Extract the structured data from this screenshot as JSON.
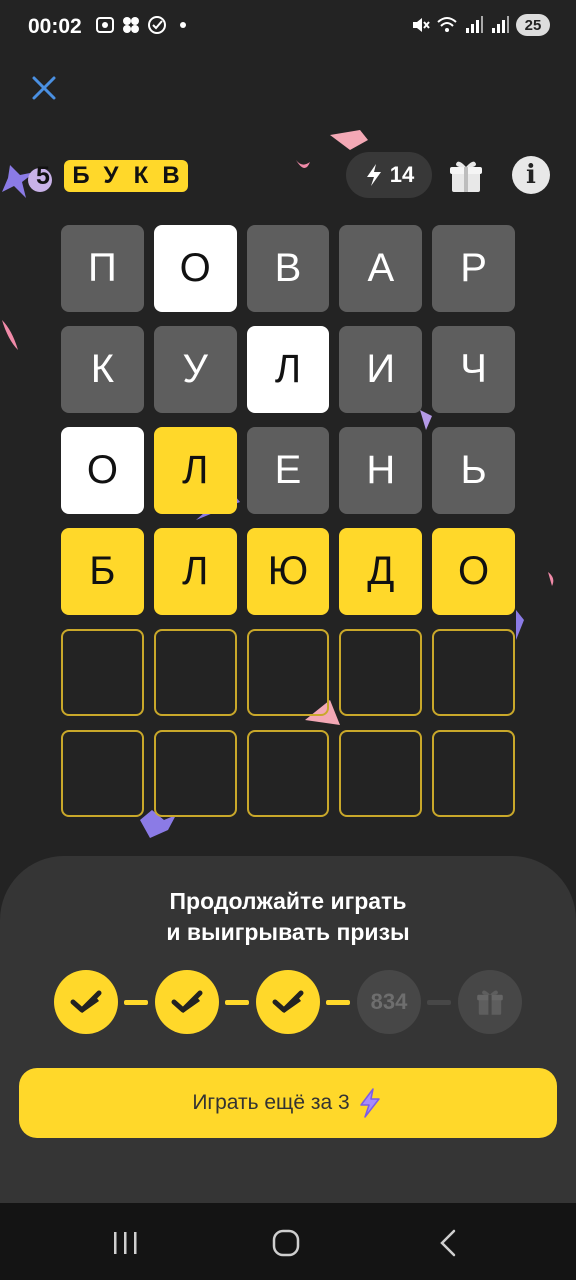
{
  "status_bar": {
    "time": "00:02",
    "battery": "25",
    "icons_left": [
      "screenshot-icon",
      "apps-icon",
      "check-circle-icon",
      "dot-icon"
    ],
    "icons_right": [
      "mute-icon",
      "wifi-icon",
      "signal-icon",
      "signal-icon"
    ]
  },
  "header": {
    "logo_number": "5",
    "logo_letters": [
      "Б",
      "У",
      "К",
      "В"
    ],
    "energy_value": "14",
    "energy_icon": "lightning-icon",
    "gift_icon": "gift-icon",
    "info_label": "i"
  },
  "grid": {
    "rows": [
      [
        {
          "letter": "П",
          "state": "gray"
        },
        {
          "letter": "О",
          "state": "white"
        },
        {
          "letter": "В",
          "state": "gray"
        },
        {
          "letter": "А",
          "state": "gray"
        },
        {
          "letter": "Р",
          "state": "gray"
        }
      ],
      [
        {
          "letter": "К",
          "state": "gray"
        },
        {
          "letter": "У",
          "state": "gray"
        },
        {
          "letter": "Л",
          "state": "white"
        },
        {
          "letter": "И",
          "state": "gray"
        },
        {
          "letter": "Ч",
          "state": "gray"
        }
      ],
      [
        {
          "letter": "О",
          "state": "white"
        },
        {
          "letter": "Л",
          "state": "yellow"
        },
        {
          "letter": "Е",
          "state": "gray"
        },
        {
          "letter": "Н",
          "state": "gray"
        },
        {
          "letter": "Ь",
          "state": "gray"
        }
      ],
      [
        {
          "letter": "Б",
          "state": "yellow"
        },
        {
          "letter": "Л",
          "state": "yellow"
        },
        {
          "letter": "Ю",
          "state": "yellow"
        },
        {
          "letter": "Д",
          "state": "yellow"
        },
        {
          "letter": "О",
          "state": "yellow"
        }
      ],
      [
        {
          "letter": "",
          "state": "empty"
        },
        {
          "letter": "",
          "state": "empty"
        },
        {
          "letter": "",
          "state": "empty"
        },
        {
          "letter": "",
          "state": "empty"
        },
        {
          "letter": "",
          "state": "empty"
        }
      ],
      [
        {
          "letter": "",
          "state": "empty"
        },
        {
          "letter": "",
          "state": "empty"
        },
        {
          "letter": "",
          "state": "empty"
        },
        {
          "letter": "",
          "state": "empty"
        },
        {
          "letter": "",
          "state": "empty"
        }
      ]
    ]
  },
  "sheet": {
    "title_line1": "Продолжайте играть",
    "title_line2": "и выигрывать призы",
    "steps": [
      {
        "state": "done",
        "label": ""
      },
      {
        "state": "done",
        "label": ""
      },
      {
        "state": "done",
        "label": ""
      },
      {
        "state": "pending",
        "label": "834"
      },
      {
        "state": "pending",
        "label": "gift-icon"
      }
    ],
    "play_button": "Играть ещё за 3"
  },
  "colors": {
    "accent": "#ffd82a",
    "background": "#232323",
    "tile_gray": "#5e5e5e",
    "sheet": "#353535"
  },
  "navbar": {
    "icons": [
      "recents-icon",
      "home-icon",
      "back-icon"
    ]
  }
}
